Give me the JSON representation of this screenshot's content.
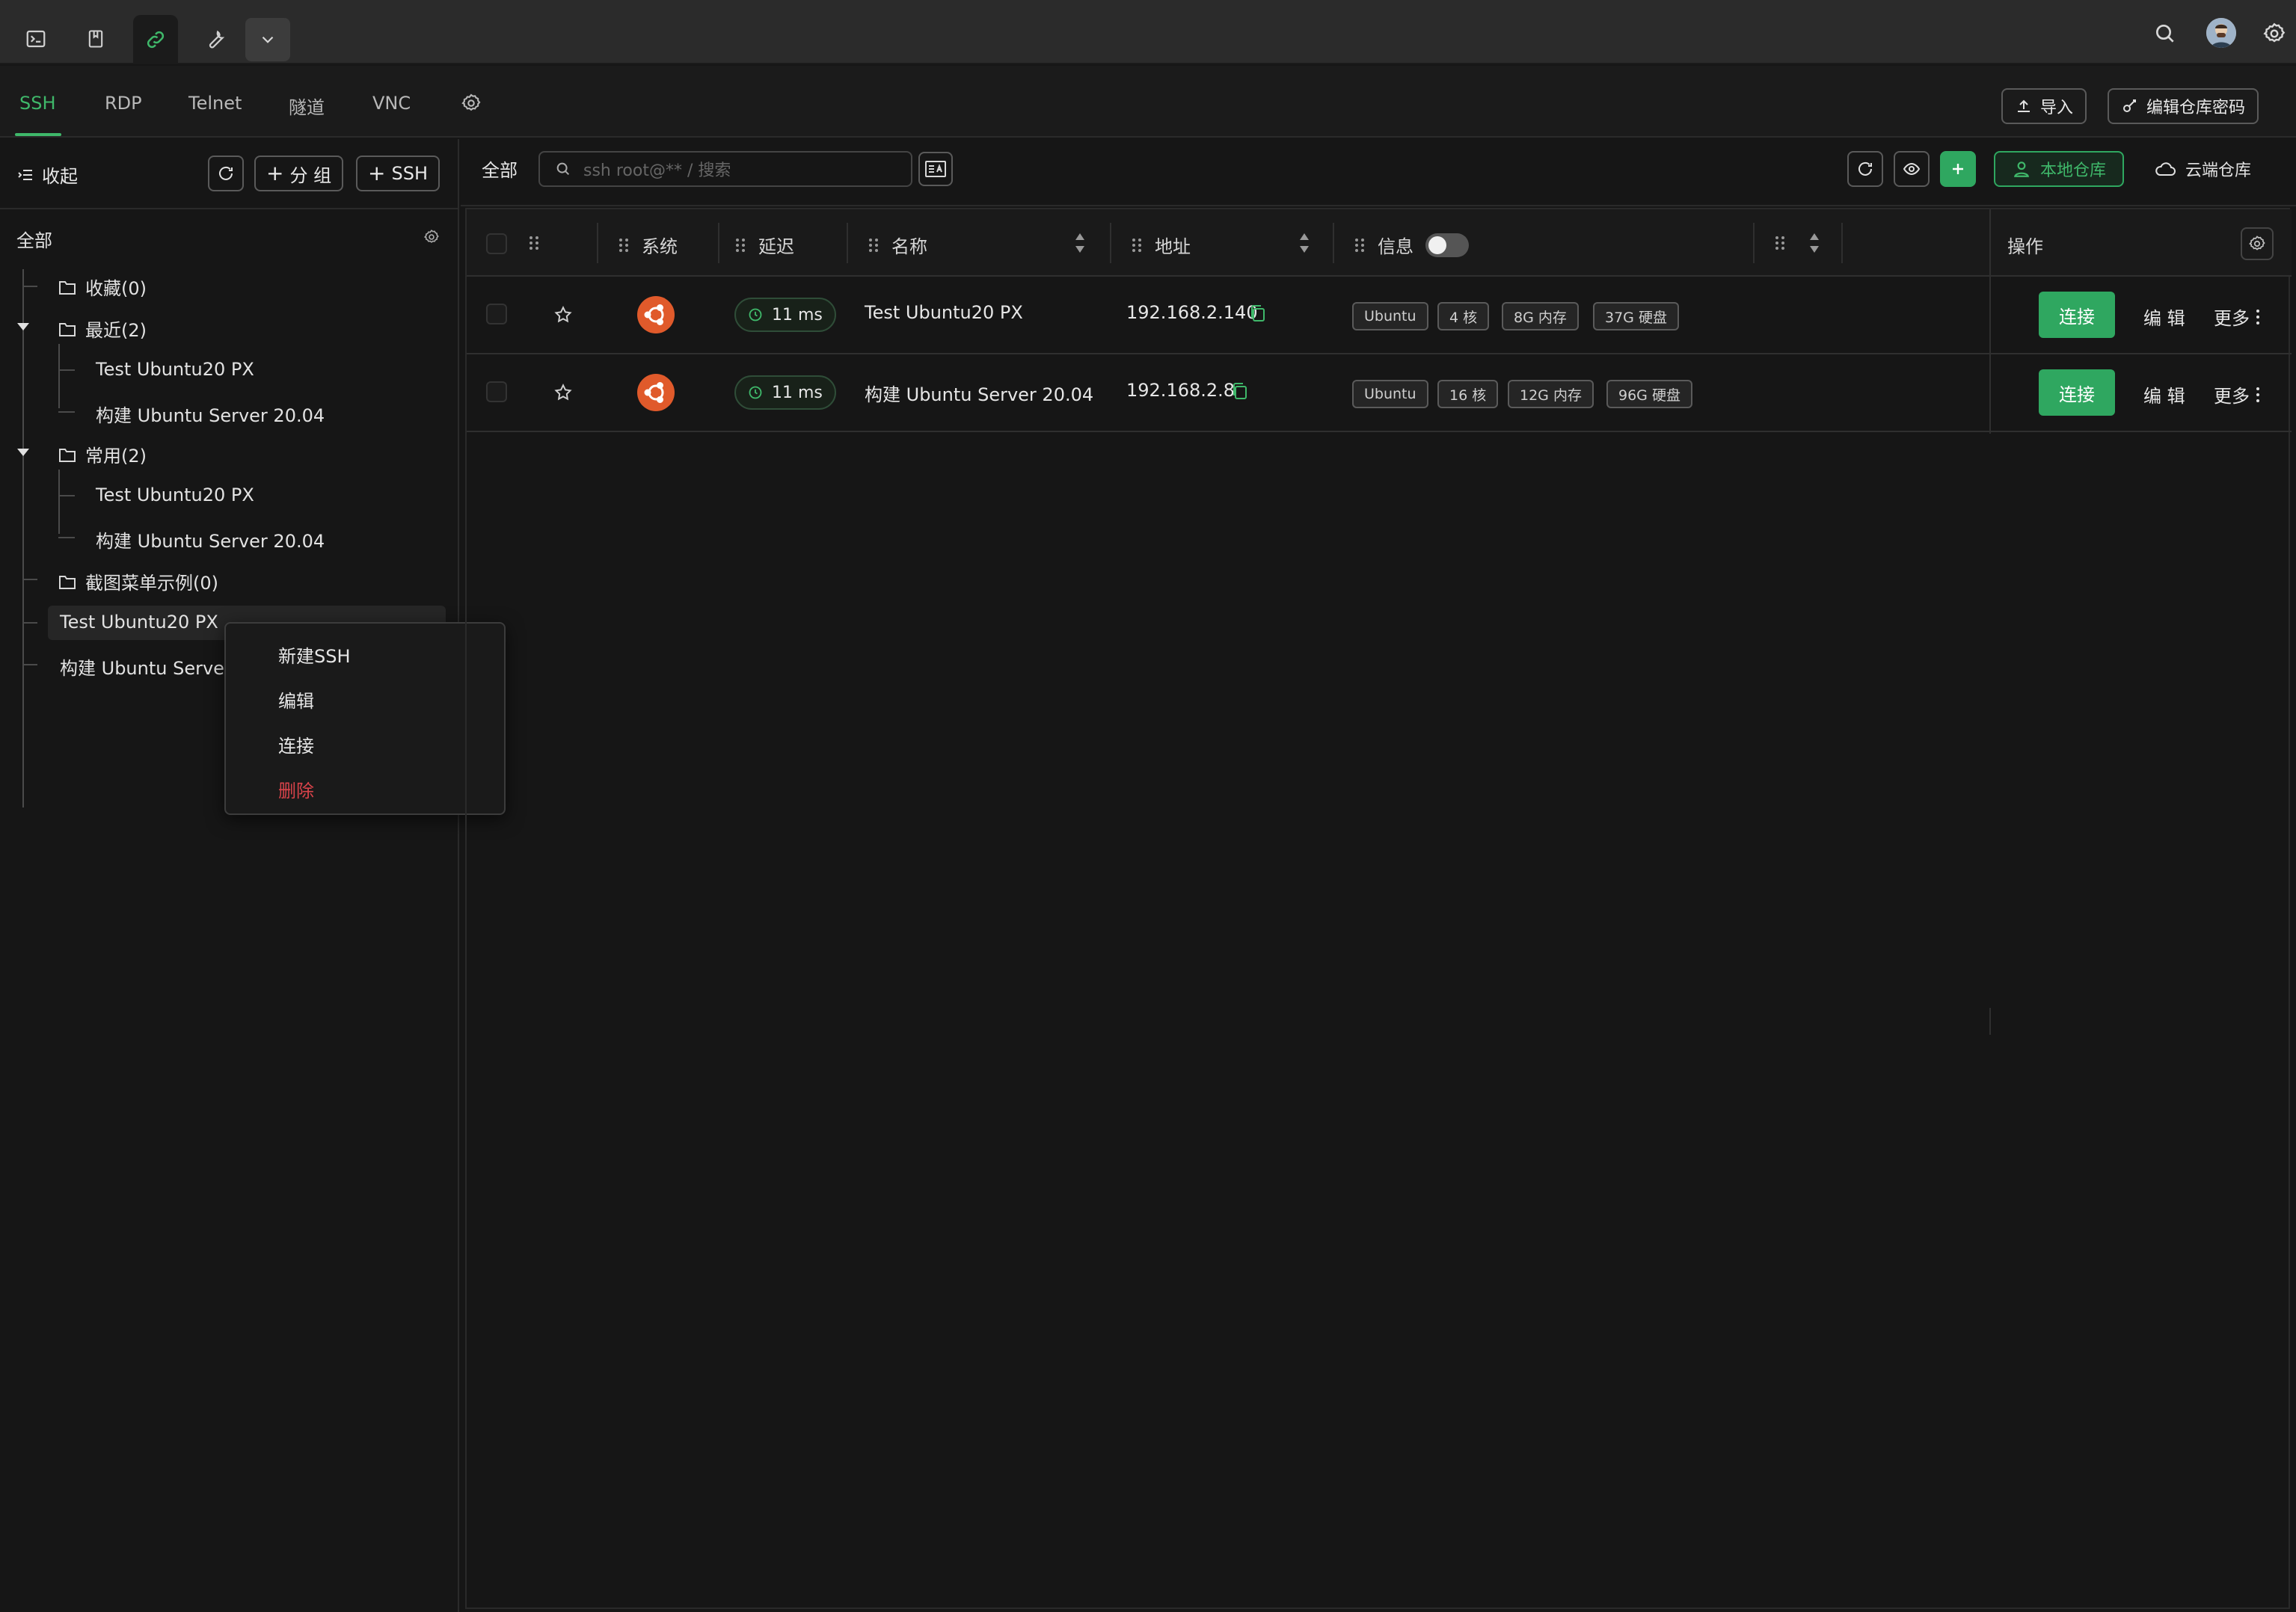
{
  "protocol_tabs": [
    "SSH",
    "RDP",
    "Telnet",
    "隧道",
    "VNC"
  ],
  "actions": {
    "import_label": "导入",
    "edit_repo_pwd_label": "编辑仓库密码"
  },
  "left": {
    "collapse_label": "收起",
    "add_group_label": "分 组",
    "add_ssh_label": "SSH",
    "all_label": "全部",
    "tree": {
      "favorites": "收藏(0)",
      "recent": "最近(2)",
      "recent_items": [
        "Test Ubuntu20 PX",
        "构建 Ubuntu Server 20.04"
      ],
      "common": "常用(2)",
      "common_items": [
        "Test Ubuntu20 PX",
        "构建 Ubuntu Server 20.04"
      ],
      "screenshot_demo": "截图菜单示例(0)",
      "root_items": [
        "Test Ubuntu20 PX",
        "构建 Ubuntu Server"
      ]
    }
  },
  "context_menu": [
    "新建SSH",
    "编辑",
    "连接",
    "删除"
  ],
  "right": {
    "all_label": "全部",
    "search_placeholder": "ssh root@** / 搜索",
    "local_repo_label": "本地仓库",
    "cloud_repo_label": "云端仓库"
  },
  "table": {
    "headers": {
      "system": "系统",
      "latency": "延迟",
      "name": "名称",
      "address": "地址",
      "info": "信息",
      "ops": "操作"
    },
    "rows": [
      {
        "latency": "11 ms",
        "name": "Test Ubuntu20 PX",
        "address": "192.168.2.140",
        "tags": [
          "Ubuntu",
          "4 核",
          "8G 内存",
          "37G 硬盘"
        ],
        "connect": "连接",
        "edit": "编 辑",
        "more": "更多"
      },
      {
        "latency": "11 ms",
        "name": "构建 Ubuntu Server 20.04",
        "address": "192.168.2.8",
        "tags": [
          "Ubuntu",
          "16 核",
          "12G 内存",
          "96G 硬盘"
        ],
        "connect": "连接",
        "edit": "编 辑",
        "more": "更多"
      }
    ]
  },
  "colors": {
    "accent": "#2fa760",
    "danger": "#d9434a",
    "background": "#161616"
  }
}
